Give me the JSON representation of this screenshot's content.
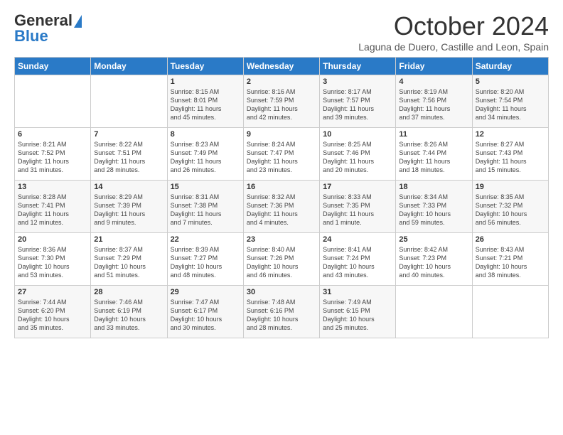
{
  "logo": {
    "general": "General",
    "blue": "Blue"
  },
  "header": {
    "month": "October 2024",
    "location": "Laguna de Duero, Castille and Leon, Spain"
  },
  "weekdays": [
    "Sunday",
    "Monday",
    "Tuesday",
    "Wednesday",
    "Thursday",
    "Friday",
    "Saturday"
  ],
  "weeks": [
    [
      {
        "day": "",
        "info": ""
      },
      {
        "day": "",
        "info": ""
      },
      {
        "day": "1",
        "info": "Sunrise: 8:15 AM\nSunset: 8:01 PM\nDaylight: 11 hours\nand 45 minutes."
      },
      {
        "day": "2",
        "info": "Sunrise: 8:16 AM\nSunset: 7:59 PM\nDaylight: 11 hours\nand 42 minutes."
      },
      {
        "day": "3",
        "info": "Sunrise: 8:17 AM\nSunset: 7:57 PM\nDaylight: 11 hours\nand 39 minutes."
      },
      {
        "day": "4",
        "info": "Sunrise: 8:19 AM\nSunset: 7:56 PM\nDaylight: 11 hours\nand 37 minutes."
      },
      {
        "day": "5",
        "info": "Sunrise: 8:20 AM\nSunset: 7:54 PM\nDaylight: 11 hours\nand 34 minutes."
      }
    ],
    [
      {
        "day": "6",
        "info": "Sunrise: 8:21 AM\nSunset: 7:52 PM\nDaylight: 11 hours\nand 31 minutes."
      },
      {
        "day": "7",
        "info": "Sunrise: 8:22 AM\nSunset: 7:51 PM\nDaylight: 11 hours\nand 28 minutes."
      },
      {
        "day": "8",
        "info": "Sunrise: 8:23 AM\nSunset: 7:49 PM\nDaylight: 11 hours\nand 26 minutes."
      },
      {
        "day": "9",
        "info": "Sunrise: 8:24 AM\nSunset: 7:47 PM\nDaylight: 11 hours\nand 23 minutes."
      },
      {
        "day": "10",
        "info": "Sunrise: 8:25 AM\nSunset: 7:46 PM\nDaylight: 11 hours\nand 20 minutes."
      },
      {
        "day": "11",
        "info": "Sunrise: 8:26 AM\nSunset: 7:44 PM\nDaylight: 11 hours\nand 18 minutes."
      },
      {
        "day": "12",
        "info": "Sunrise: 8:27 AM\nSunset: 7:43 PM\nDaylight: 11 hours\nand 15 minutes."
      }
    ],
    [
      {
        "day": "13",
        "info": "Sunrise: 8:28 AM\nSunset: 7:41 PM\nDaylight: 11 hours\nand 12 minutes."
      },
      {
        "day": "14",
        "info": "Sunrise: 8:29 AM\nSunset: 7:39 PM\nDaylight: 11 hours\nand 9 minutes."
      },
      {
        "day": "15",
        "info": "Sunrise: 8:31 AM\nSunset: 7:38 PM\nDaylight: 11 hours\nand 7 minutes."
      },
      {
        "day": "16",
        "info": "Sunrise: 8:32 AM\nSunset: 7:36 PM\nDaylight: 11 hours\nand 4 minutes."
      },
      {
        "day": "17",
        "info": "Sunrise: 8:33 AM\nSunset: 7:35 PM\nDaylight: 11 hours\nand 1 minute."
      },
      {
        "day": "18",
        "info": "Sunrise: 8:34 AM\nSunset: 7:33 PM\nDaylight: 10 hours\nand 59 minutes."
      },
      {
        "day": "19",
        "info": "Sunrise: 8:35 AM\nSunset: 7:32 PM\nDaylight: 10 hours\nand 56 minutes."
      }
    ],
    [
      {
        "day": "20",
        "info": "Sunrise: 8:36 AM\nSunset: 7:30 PM\nDaylight: 10 hours\nand 53 minutes."
      },
      {
        "day": "21",
        "info": "Sunrise: 8:37 AM\nSunset: 7:29 PM\nDaylight: 10 hours\nand 51 minutes."
      },
      {
        "day": "22",
        "info": "Sunrise: 8:39 AM\nSunset: 7:27 PM\nDaylight: 10 hours\nand 48 minutes."
      },
      {
        "day": "23",
        "info": "Sunrise: 8:40 AM\nSunset: 7:26 PM\nDaylight: 10 hours\nand 46 minutes."
      },
      {
        "day": "24",
        "info": "Sunrise: 8:41 AM\nSunset: 7:24 PM\nDaylight: 10 hours\nand 43 minutes."
      },
      {
        "day": "25",
        "info": "Sunrise: 8:42 AM\nSunset: 7:23 PM\nDaylight: 10 hours\nand 40 minutes."
      },
      {
        "day": "26",
        "info": "Sunrise: 8:43 AM\nSunset: 7:21 PM\nDaylight: 10 hours\nand 38 minutes."
      }
    ],
    [
      {
        "day": "27",
        "info": "Sunrise: 7:44 AM\nSunset: 6:20 PM\nDaylight: 10 hours\nand 35 minutes."
      },
      {
        "day": "28",
        "info": "Sunrise: 7:46 AM\nSunset: 6:19 PM\nDaylight: 10 hours\nand 33 minutes."
      },
      {
        "day": "29",
        "info": "Sunrise: 7:47 AM\nSunset: 6:17 PM\nDaylight: 10 hours\nand 30 minutes."
      },
      {
        "day": "30",
        "info": "Sunrise: 7:48 AM\nSunset: 6:16 PM\nDaylight: 10 hours\nand 28 minutes."
      },
      {
        "day": "31",
        "info": "Sunrise: 7:49 AM\nSunset: 6:15 PM\nDaylight: 10 hours\nand 25 minutes."
      },
      {
        "day": "",
        "info": ""
      },
      {
        "day": "",
        "info": ""
      }
    ]
  ]
}
